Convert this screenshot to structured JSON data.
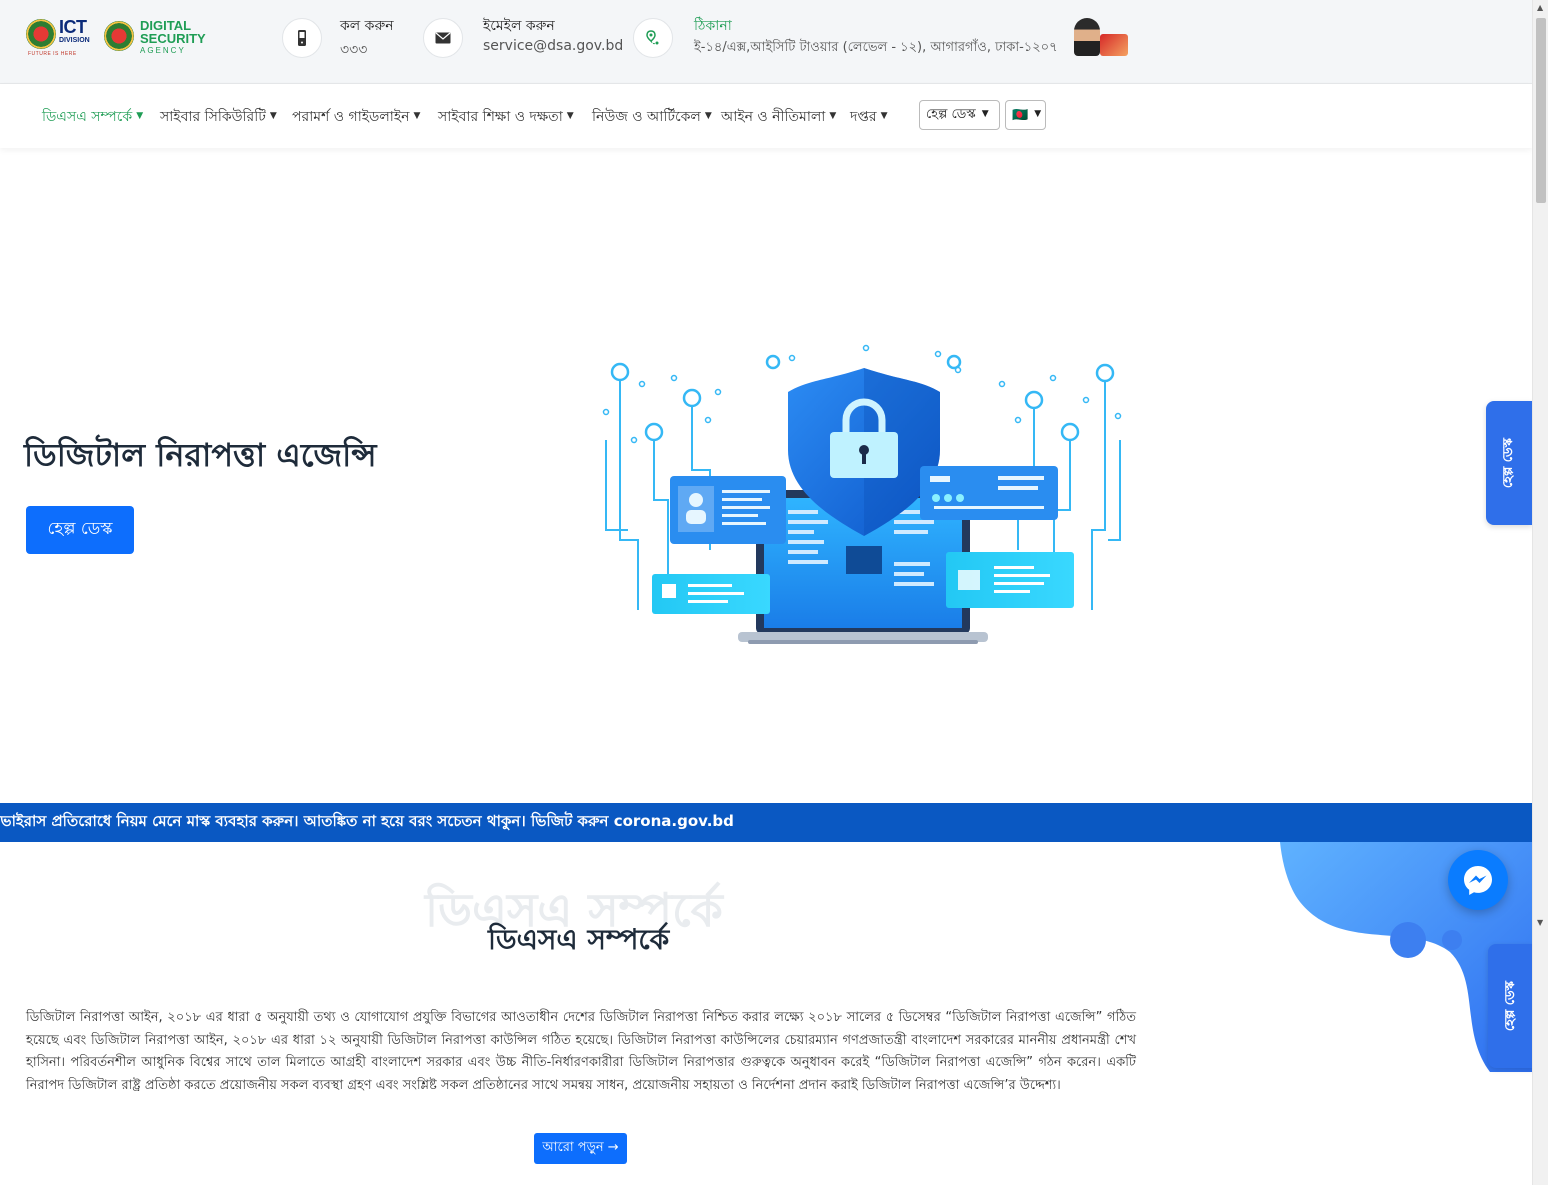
{
  "header": {
    "ict_logo_text": "ICT",
    "ict_logo_sub": "DIVISION",
    "ict_tagline": "FUTURE IS HERE",
    "dsa_logo_line1": "DIGITAL",
    "dsa_logo_line2": "SECURITY",
    "dsa_logo_line3": "AGENCY",
    "call": {
      "title": "কল করুন",
      "value": "৩৩৩",
      "icon": "phone-icon"
    },
    "email": {
      "title": "ইমেইল করুন",
      "value": "service@dsa.gov.bd",
      "icon": "envelope-icon"
    },
    "address": {
      "title": "ঠিকানা",
      "value": "ই-১৪/এক্স,আইসিটি টাওয়ার (লেভেল - ১২), আগারগাঁও, ঢাকা-১২০৭",
      "icon": "map-pin-icon"
    }
  },
  "nav": {
    "items": [
      {
        "label": "ডিএসএ সম্পর্কে",
        "active": true
      },
      {
        "label": "সাইবার সিকিউরিটি"
      },
      {
        "label": "পরামর্শ ও গাইডলাইন"
      },
      {
        "label": "সাইবার শিক্ষা ও দক্ষতা"
      },
      {
        "label": "নিউজ ও আর্টিকেল"
      },
      {
        "label": "আইন ও নীতিমালা"
      },
      {
        "label": "দপ্তর"
      }
    ],
    "helpdesk_select": "হেল্প ডেস্ক",
    "language_select": "🇧🇩"
  },
  "hero": {
    "title": "ডিজিটাল নিরাপত্তা এজেন্সি",
    "button": "হেল্প ডেস্ক"
  },
  "side_tabs": {
    "top": "হেল্প ডেস্ক",
    "bottom": "হেল্প ডেস্ক"
  },
  "ticker": {
    "text": "াভাইরাস প্রতিরোধে নিয়ম মেনে মাস্ক ব্যবহার করুন। আতঙ্কিত না হয়ে বরং সচেতন থাকুন। ভিজিট করুন corona.gov.bd"
  },
  "about": {
    "bg_title": "ডিএসএ সম্পর্কে",
    "title": "ডিএসএ সম্পর্কে",
    "text": "ডিজিটাল নিরাপত্তা আইন, ২০১৮ এর ধারা ৫ অনুযায়ী তথ্য ও যোগাযোগ প্রযুক্তি বিভাগের আওতাধীন দেশের ডিজিটাল নিরাপত্তা নিশ্চিত করার লক্ষ্যে ২০১৮ সালের ৫ ডিসেম্বর “ডিজিটাল নিরাপত্তা এজেন্সি” গঠিত হয়েছে এবং ডিজিটাল নিরাপত্তা আইন, ২০১৮ এর ধারা ১২ অনুযায়ী ডিজিটাল নিরাপত্তা কাউন্সিল গঠিত হয়েছে। ডিজিটাল নিরাপত্তা কাউন্সিলের চেয়ারম্যান গণপ্রজাতন্ত্রী বাংলাদেশ সরকারের মাননীয় প্রধানমন্ত্রী শেখ হাসিনা। পরিবর্তনশীল আধুনিক বিশ্বের সাথে তাল মিলাতে আগ্রহী বাংলাদেশ সরকার এবং উচ্চ নীতি-নির্ধারণকারীরা ডিজিটাল নিরাপত্তার গুরুত্বকে অনুধাবন করেই “ডিজিটাল নিরাপত্তা এজেন্সি” গঠন করেন। একটি নিরাপদ ডিজিটাল রাষ্ট্র প্রতিষ্ঠা করতে প্রয়োজনীয় সকল ব্যবস্থা গ্রহণ এবং সংশ্লিষ্ট সকল প্রতিষ্ঠানের সাথে সমন্বয় সাধন, প্রয়োজনীয় সহায়তা ও নির্দেশনা প্রদান করাই ডিজিটাল নিরাপত্তা এজেন্সি’র উদ্দেশ্য।",
    "more_button": "আরো পড়ুন →"
  },
  "colors": {
    "primary_blue": "#0d6efd",
    "brand_green": "#1f9d55",
    "ticker_blue": "#0a58c2",
    "side_tab_blue": "#2f6fea"
  }
}
